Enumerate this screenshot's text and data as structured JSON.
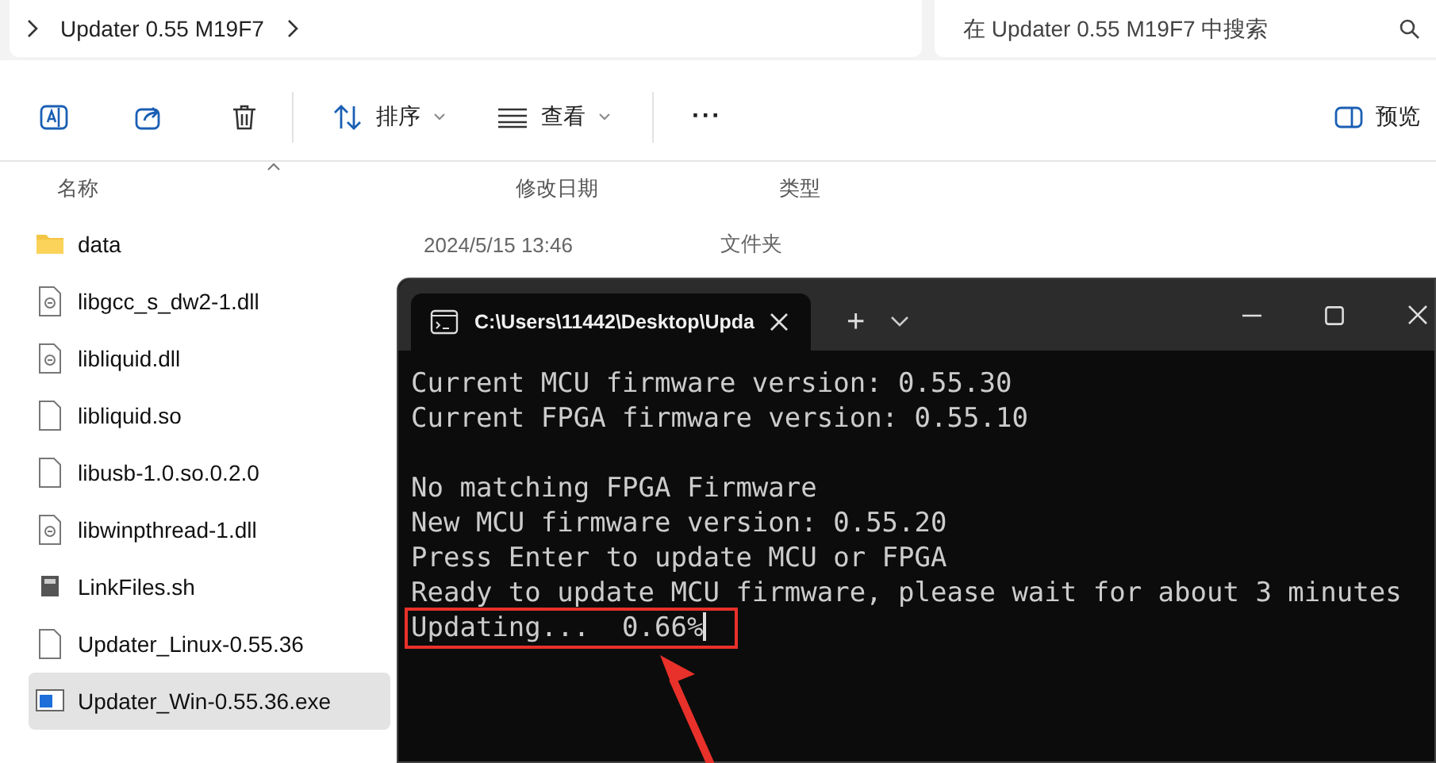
{
  "address_bar": {
    "path": "Updater 0.55 M19F7"
  },
  "search": {
    "placeholder": "在 Updater 0.55 M19F7 中搜索"
  },
  "toolbar": {
    "sort": "排序",
    "view": "查看",
    "more": "···",
    "preview": "预览"
  },
  "columns": [
    "名称",
    "修改日期",
    "类型"
  ],
  "files": [
    {
      "name": "data",
      "kind": "folder",
      "date": "2024/5/15 13:46",
      "type": "文件夹",
      "selected": false
    },
    {
      "name": "libgcc_s_dw2-1.dll",
      "kind": "dll",
      "selected": false
    },
    {
      "name": "libliquid.dll",
      "kind": "dll",
      "selected": false
    },
    {
      "name": "libliquid.so",
      "kind": "file",
      "selected": false
    },
    {
      "name": "libusb-1.0.so.0.2.0",
      "kind": "file",
      "selected": false
    },
    {
      "name": "libwinpthread-1.dll",
      "kind": "dll",
      "selected": false
    },
    {
      "name": "LinkFiles.sh",
      "kind": "script",
      "selected": false
    },
    {
      "name": "Updater_Linux-0.55.36",
      "kind": "file",
      "selected": false
    },
    {
      "name": "Updater_Win-0.55.36.exe",
      "kind": "exe",
      "selected": true
    }
  ],
  "terminal": {
    "tab_title": "C:\\Users\\11442\\Desktop\\Upda",
    "new_tab": "+",
    "blocks": [
      {
        "lines": [
          {
            "text": "Current MCU firmware version: 0.55.30",
            "highlighted": false
          },
          {
            "text": "Current FPGA firmware version: 0.55.10",
            "highlighted": false
          }
        ]
      },
      {
        "lines": [
          {
            "text": "No matching FPGA Firmware",
            "highlighted": false
          },
          {
            "text": "New MCU firmware version: 0.55.20",
            "highlighted": false
          },
          {
            "text": "Press Enter to update MCU or FPGA",
            "highlighted": false
          },
          {
            "text": "Ready to update MCU firmware, please wait for about 3 minutes",
            "highlighted": false
          },
          {
            "text": "Updating...  0.66%",
            "highlighted": true
          }
        ]
      }
    ]
  }
}
